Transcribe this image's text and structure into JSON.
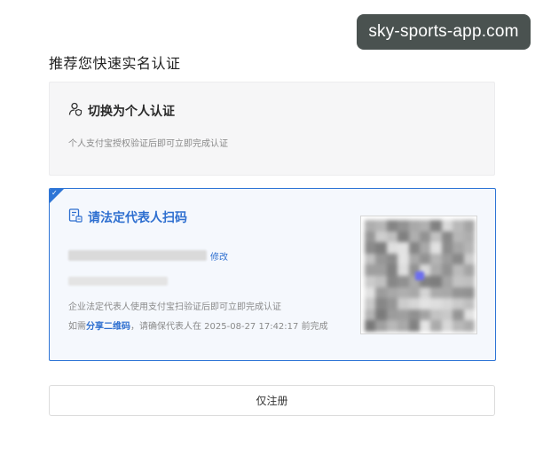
{
  "watermark": "sky-sports-app.com",
  "page": {
    "title": "推荐您快速实名认证"
  },
  "person_option": {
    "title": "切换为个人认证",
    "description": "个人支付宝授权验证后即可立即完成认证",
    "icon": "person-shield-icon"
  },
  "legal_option": {
    "selected": true,
    "title": "请法定代表人扫码",
    "icon": "document-scan-icon",
    "edit_label": "修改",
    "description": "企业法定代表人使用支付宝扫验证后即可立即完成认证",
    "hint_prefix": "如需",
    "share_label": "分享二维码",
    "hint_suffix": "，请确保代表人在 2025-08-27 17:42:17 前完成"
  },
  "register_button": {
    "label": "仅注册"
  },
  "colors": {
    "accent": "#2e75d6",
    "selected_bg": "#f5f8fd",
    "muted": "#8a8a8a"
  }
}
